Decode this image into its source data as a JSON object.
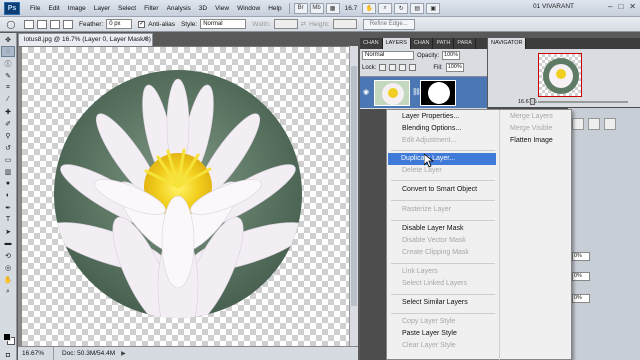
{
  "menubar": {
    "logo": "Ps",
    "items": [
      "File",
      "Edit",
      "Image",
      "Layer",
      "Select",
      "Filter",
      "Analysis",
      "3D",
      "View",
      "Window",
      "Help"
    ],
    "zoom": "16.7",
    "workspace": "01 VIVARANT"
  },
  "options": {
    "feather_label": "Feather:",
    "feather_value": "0 px",
    "antialias_label": "Anti-alias",
    "style_label": "Style:",
    "style_value": "Normal",
    "width_label": "Width:",
    "height_label": "Height:",
    "refine_edge": "Refine Edge..."
  },
  "document": {
    "tab_title": "lotus8.jpg @ 16.7% (Layer 0, Layer Mask/8) *",
    "status_zoom": "16.67%",
    "status_doc": "Doc: 50.3M/54.4M"
  },
  "layers_panel": {
    "tabs": [
      "CHAN",
      "LAYERS",
      "CHAN",
      "PATH",
      "PARA"
    ],
    "blend_mode": "Normal",
    "opacity_label": "Opacity:",
    "opacity_value": "100%",
    "lock_label": "Lock:",
    "fill_label": "Fill:",
    "fill_value": "100%"
  },
  "navigator_panel": {
    "tab": "NAVIGATOR",
    "zoom": "16.67%"
  },
  "side_fields": [
    "0%",
    "0%",
    "0%"
  ],
  "context_menu": {
    "items": [
      {
        "label": "Layer Properties...",
        "disabled": false
      },
      {
        "label": "Blending Options...",
        "disabled": false
      },
      {
        "label": "Edit Adjustment...",
        "disabled": true
      },
      {
        "label": "Duplicate Layer...",
        "disabled": false,
        "highlighted": true
      },
      {
        "label": "Delete Layer",
        "disabled": true
      },
      {
        "label": "Convert to Smart Object",
        "disabled": false
      },
      {
        "label": "Rasterize Layer",
        "disabled": true
      },
      {
        "label": "Disable Layer Mask",
        "disabled": false
      },
      {
        "label": "Disable Vector Mask",
        "disabled": true
      },
      {
        "label": "Create Clipping Mask",
        "disabled": true
      },
      {
        "label": "Link Layers",
        "disabled": true
      },
      {
        "label": "Select Linked Layers",
        "disabled": true
      },
      {
        "label": "Select Similar Layers",
        "disabled": false
      },
      {
        "label": "Copy Layer Style",
        "disabled": true
      },
      {
        "label": "Paste Layer Style",
        "disabled": false
      },
      {
        "label": "Clear Layer Style",
        "disabled": true
      }
    ],
    "right_items": [
      {
        "label": "Merge Layers",
        "disabled": true
      },
      {
        "label": "Merge Visible",
        "disabled": true
      },
      {
        "label": "Flatten Image",
        "disabled": false
      }
    ]
  },
  "colors": {
    "highlight": "#3f7ad8",
    "selected_layer": "#4c77b5"
  }
}
